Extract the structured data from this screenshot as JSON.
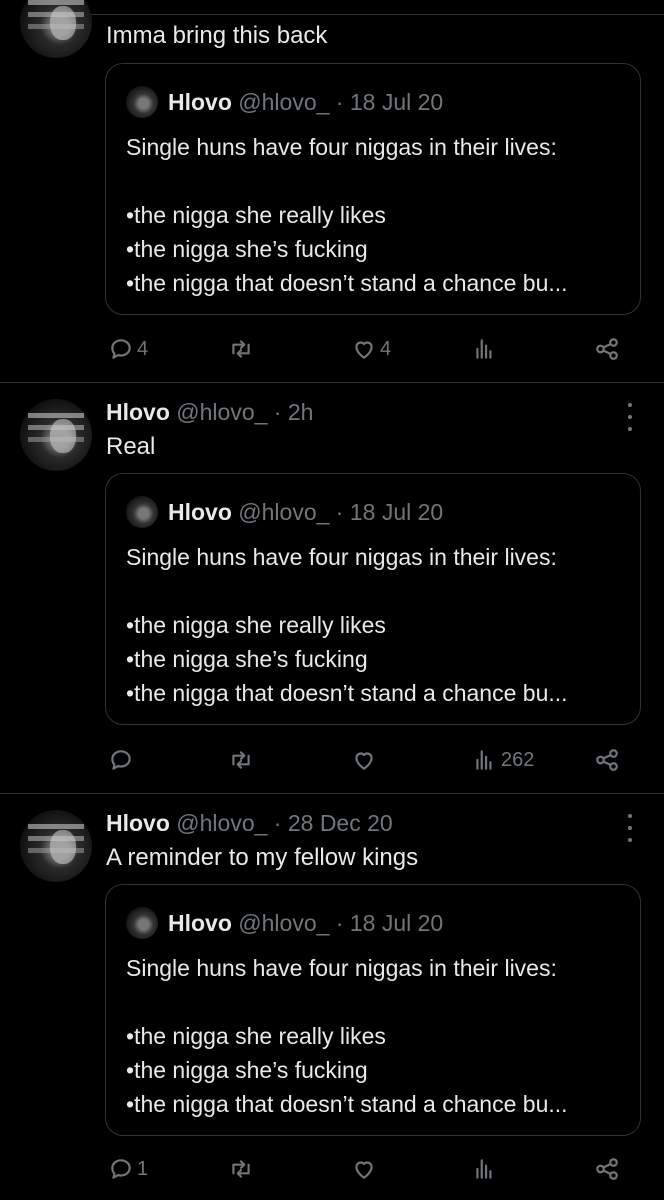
{
  "quoted": {
    "name": "Hlovo",
    "handle": "@hlovo_",
    "date": "· 18 Jul 20",
    "text": "Single huns have four niggas in their lives:\n\n•the nigga she really likes\n•the nigga she’s fucking\n•the nigga that doesn’t stand a chance bu..."
  },
  "tweets": [
    {
      "text": "Imma bring this back",
      "replies": "4",
      "retweets": "",
      "likes": "4",
      "views": ""
    },
    {
      "name": "Hlovo",
      "handle": "@hlovo_",
      "time": "· 2h",
      "text": "Real",
      "replies": "",
      "retweets": "",
      "likes": "",
      "views": "262"
    },
    {
      "name": "Hlovo",
      "handle": "@hlovo_",
      "time": "· 28 Dec 20",
      "text": "A reminder to my fellow kings",
      "replies": "1",
      "retweets": "",
      "likes": "",
      "views": ""
    }
  ]
}
